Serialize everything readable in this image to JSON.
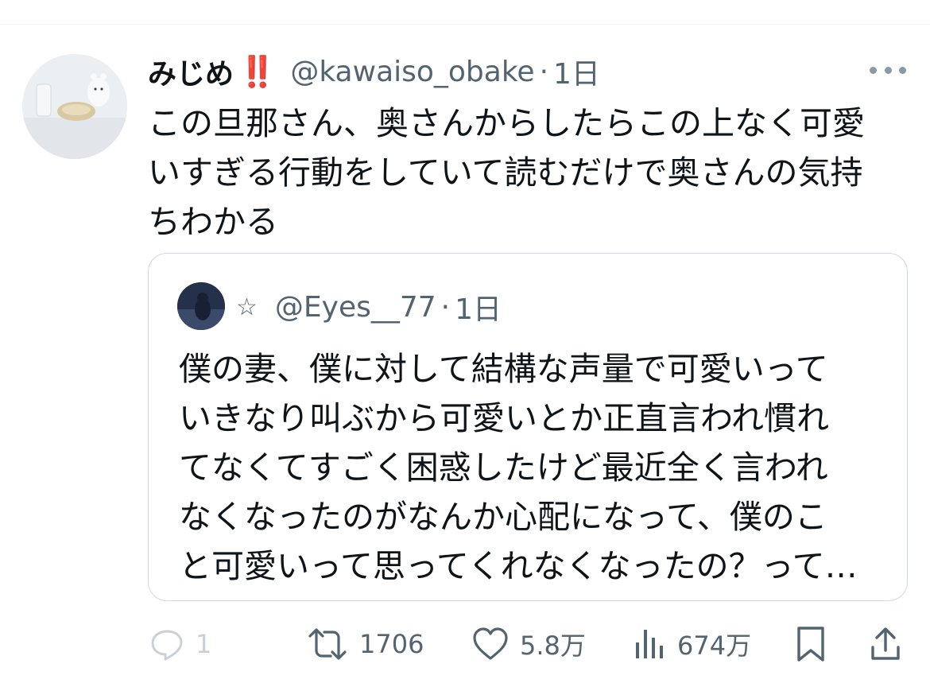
{
  "tweet": {
    "display_name": "みじめ",
    "badge": "‼️",
    "handle": "@kawaiso_obake",
    "separator": "·",
    "time": "1日",
    "text": "この旦那さん、奥さんからしたらこの上なく可愛\nいすぎる行動をしていて読むだけで奥さんの気持\nちわかる",
    "avatar_icon": "cat-figurine-photo",
    "more_icon": "more-dots-icon"
  },
  "quote": {
    "star": "☆",
    "handle": "@Eyes__77",
    "separator": "·",
    "time": "1日",
    "text": "僕の妻、僕に対して結構な声量で可愛いって\nいきなり叫ぶから可愛いとか正直言われ慣れ\nてなくてすごく困惑したけど最近全く言われ\nなくなったのがなんか心配になって、僕のこ\nと可愛いって思ってくれなくなったの？って…"
  },
  "actions": {
    "reply": {
      "icon": "reply-icon",
      "count": "1"
    },
    "retweet": {
      "icon": "retweet-icon",
      "count": "1706"
    },
    "like": {
      "icon": "heart-icon",
      "count": "5.8万"
    },
    "views": {
      "icon": "views-icon",
      "count": "674万"
    },
    "bookmark": {
      "icon": "bookmark-icon"
    },
    "share": {
      "icon": "share-icon"
    }
  },
  "colors": {
    "text": "#0f1419",
    "secondary": "#536471",
    "border": "#cfd9de",
    "badge": "#e0245e"
  }
}
